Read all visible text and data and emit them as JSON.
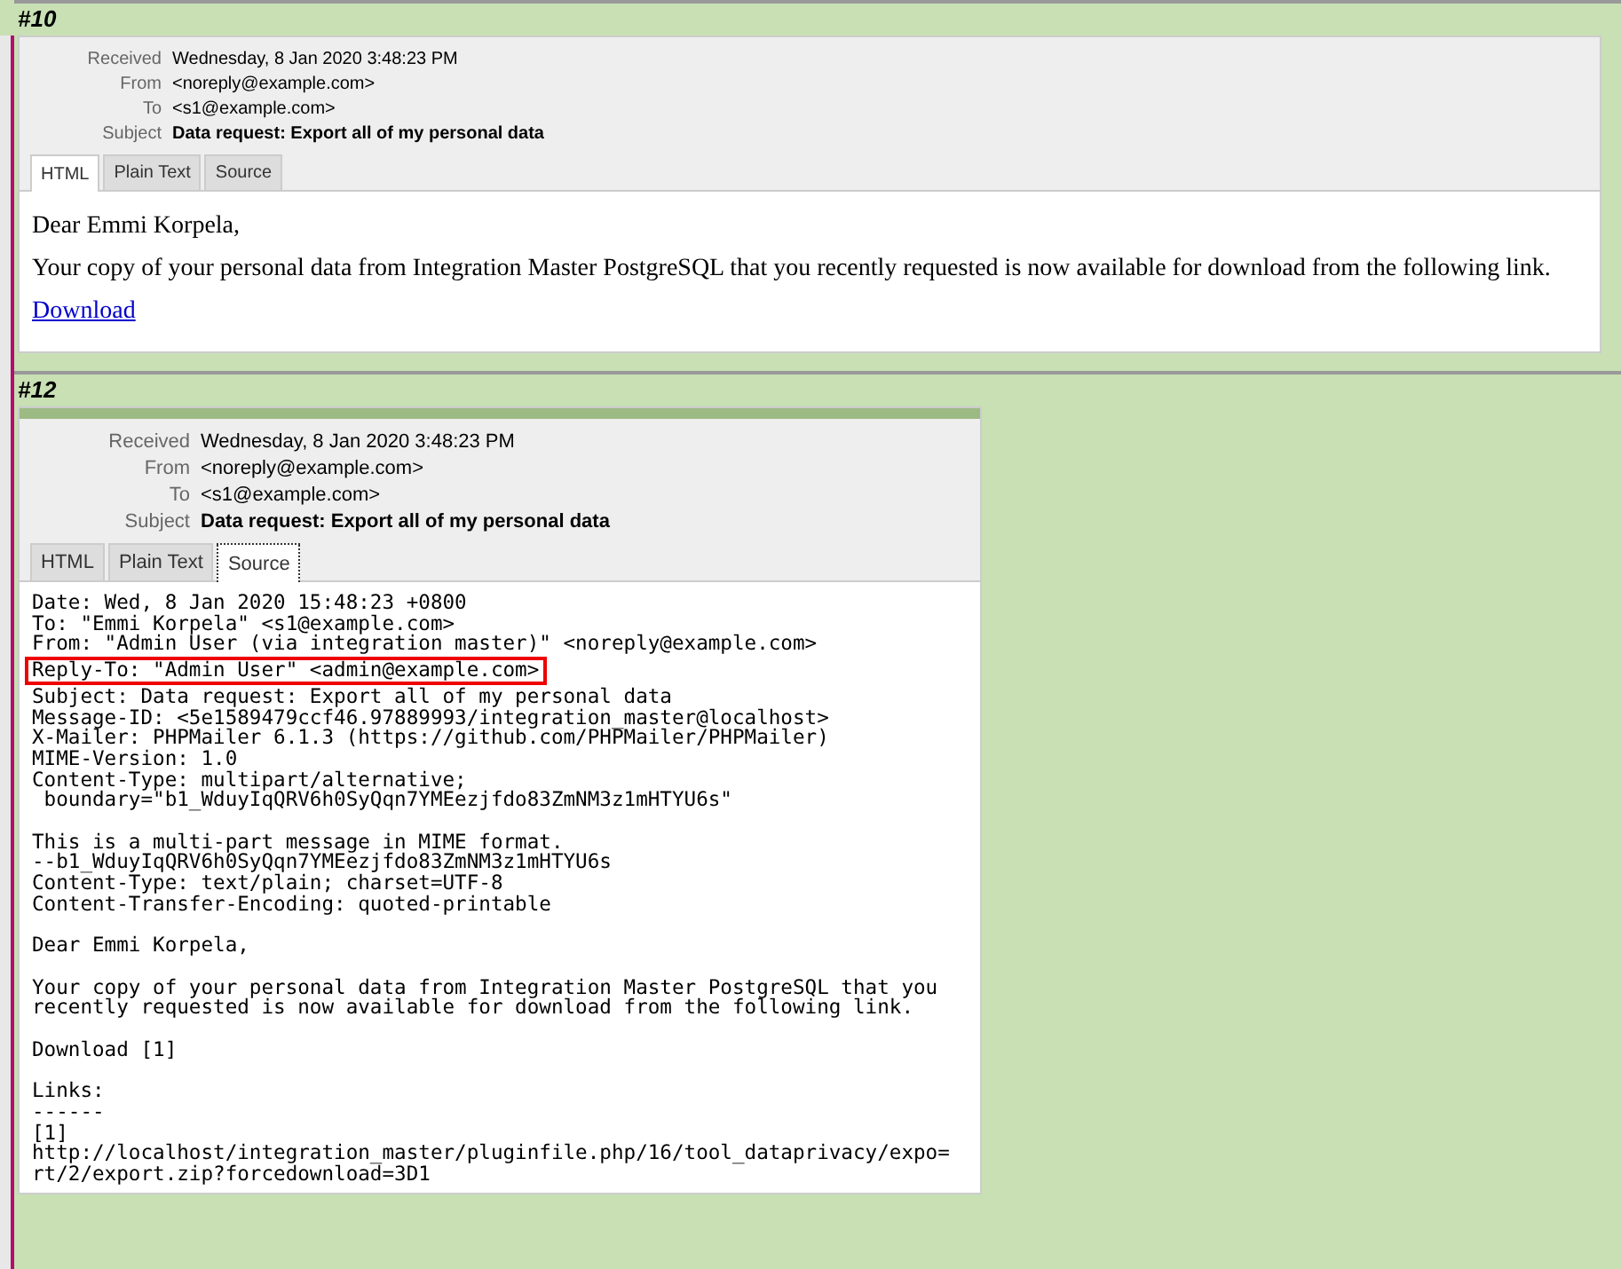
{
  "messages": [
    {
      "number": "#10",
      "headers": [
        {
          "label": "Received",
          "value": "Wednesday, 8 Jan 2020 3:48:23 PM",
          "bold": false
        },
        {
          "label": "From",
          "value": "<noreply@example.com>",
          "bold": false
        },
        {
          "label": "To",
          "value": "<s1@example.com>",
          "bold": false
        },
        {
          "label": "Subject",
          "value": "Data request: Export all of my personal data",
          "bold": true
        }
      ],
      "tabs": [
        {
          "label": "HTML",
          "selected": true
        },
        {
          "label": "Plain Text",
          "selected": false
        },
        {
          "label": "Source",
          "selected": false
        }
      ],
      "body": {
        "kind": "html",
        "paragraphs": [
          "Dear Emmi Korpela,",
          "Your copy of your personal data from Integration Master PostgreSQL that you recently requested is now available for download from the following link."
        ],
        "link": "Download"
      }
    },
    {
      "number": "#12",
      "headers": [
        {
          "label": "Received",
          "value": "Wednesday, 8 Jan 2020 3:48:23 PM",
          "bold": false
        },
        {
          "label": "From",
          "value": "<noreply@example.com>",
          "bold": false
        },
        {
          "label": "To",
          "value": "<s1@example.com>",
          "bold": false
        },
        {
          "label": "Subject",
          "value": "Data request: Export all of my personal data",
          "bold": true
        }
      ],
      "tabs": [
        {
          "label": "HTML",
          "selected": false
        },
        {
          "label": "Plain Text",
          "selected": false
        },
        {
          "label": "Source",
          "selected": true
        }
      ],
      "body": {
        "kind": "source",
        "blocks": [
          [
            {
              "text": "Date: Wed, 8 Jan 2020 15:48:23 +0800",
              "highlighted": false
            },
            {
              "text": "To: \"Emmi Korpela\" <s1@example.com>",
              "highlighted": false
            },
            {
              "text": "From: \"Admin User (via integration master)\" <noreply@example.com>",
              "highlighted": false
            },
            {
              "text": "Reply-To: \"Admin User\" <admin@example.com>",
              "highlighted": true
            },
            {
              "text": "Subject: Data request: Export all of my personal data",
              "highlighted": false
            },
            {
              "text": "Message-ID: <5e1589479ccf46.97889993/integration_master@localhost>",
              "highlighted": false
            },
            {
              "text": "X-Mailer: PHPMailer 6.1.3 (https://github.com/PHPMailer/PHPMailer)",
              "highlighted": false
            },
            {
              "text": "MIME-Version: 1.0",
              "highlighted": false
            },
            {
              "text": "Content-Type: multipart/alternative;",
              "highlighted": false
            },
            {
              "text": " boundary=\"b1_WduyIqQRV6h0SyQqn7YMEezjfdo83ZmNM3z1mHTYU6s\"",
              "highlighted": false
            }
          ],
          [
            {
              "text": "This is a multi-part message in MIME format.",
              "highlighted": false
            },
            {
              "text": "--b1_WduyIqQRV6h0SyQqn7YMEezjfdo83ZmNM3z1mHTYU6s",
              "highlighted": false
            },
            {
              "text": "Content-Type: text/plain; charset=UTF-8",
              "highlighted": false
            },
            {
              "text": "Content-Transfer-Encoding: quoted-printable",
              "highlighted": false
            }
          ],
          [
            {
              "text": "Dear Emmi Korpela,",
              "highlighted": false
            }
          ],
          [
            {
              "text": "Your copy of your personal data from Integration Master PostgreSQL that you",
              "highlighted": false
            },
            {
              "text": "recently requested is now available for download from the following link.",
              "highlighted": false
            }
          ],
          [
            {
              "text": "Download [1]",
              "highlighted": false
            }
          ],
          [
            {
              "text": "Links:",
              "highlighted": false
            },
            {
              "text": "------",
              "highlighted": false
            },
            {
              "text": "[1]",
              "highlighted": false
            },
            {
              "text": "http://localhost/integration_master/pluginfile.php/16/tool_dataprivacy/expo=",
              "highlighted": false
            },
            {
              "text": "rt/2/export.zip?forcedownload=3D1",
              "highlighted": false
            }
          ]
        ]
      }
    }
  ]
}
